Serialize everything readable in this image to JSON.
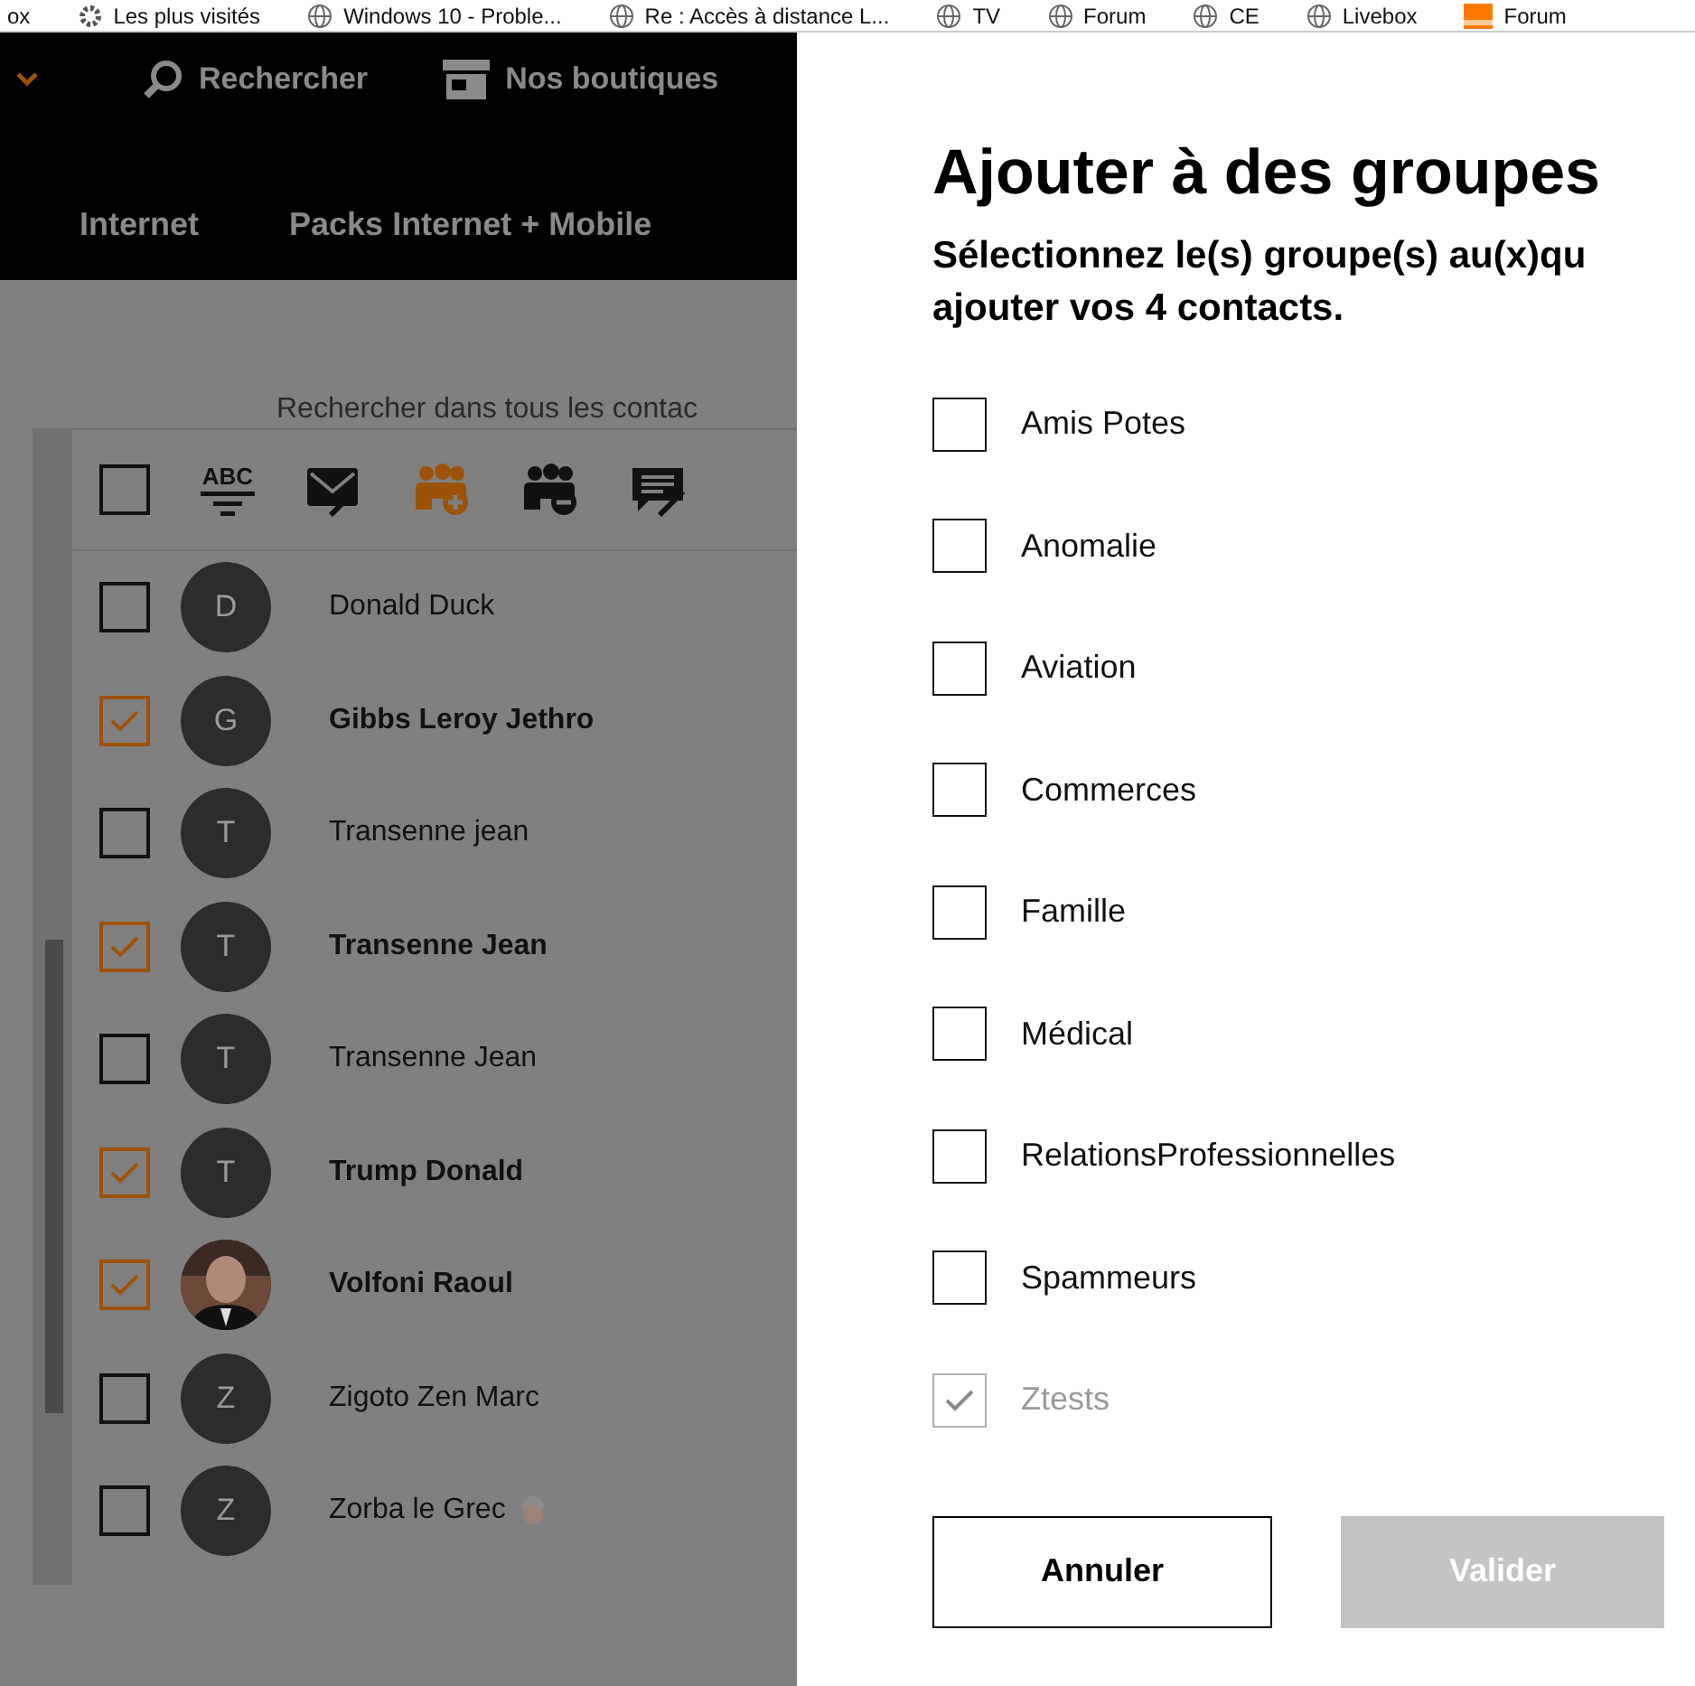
{
  "bookmarks": [
    {
      "label": "ox",
      "kind": "plain"
    },
    {
      "label": "Les plus visités",
      "kind": "gear"
    },
    {
      "label": "Windows 10 - Proble...",
      "kind": "globe"
    },
    {
      "label": "Re : Accès à distance L...",
      "kind": "globe"
    },
    {
      "label": "TV",
      "kind": "globe"
    },
    {
      "label": "Forum",
      "kind": "globe"
    },
    {
      "label": "CE",
      "kind": "globe"
    },
    {
      "label": "Livebox",
      "kind": "globe"
    },
    {
      "label": "Forum",
      "kind": "brand"
    }
  ],
  "header": {
    "search_label": "Rechercher",
    "shops_label": "Nos boutiques",
    "menu": [
      "Internet",
      "Packs Internet + Mobile"
    ]
  },
  "search_hint": "Rechercher dans tous les contac",
  "toolbar": {
    "select_all": false,
    "sort_label": "ABC"
  },
  "contacts": [
    {
      "name": "Donald Duck",
      "initial": "D",
      "kind": "initial",
      "checked": false,
      "emoji": false
    },
    {
      "name": "Gibbs Leroy Jethro",
      "initial": "G",
      "kind": "initial",
      "checked": true,
      "emoji": false
    },
    {
      "name": "Transenne jean",
      "initial": "T",
      "kind": "initial",
      "checked": false,
      "emoji": false
    },
    {
      "name": "Transenne Jean",
      "initial": "T",
      "kind": "initial",
      "checked": true,
      "emoji": false
    },
    {
      "name": "Transenne Jean",
      "initial": "T",
      "kind": "initial",
      "checked": false,
      "emoji": false
    },
    {
      "name": "Trump Donald",
      "initial": "T",
      "kind": "initial",
      "checked": true,
      "emoji": false
    },
    {
      "name": "Volfoni Raoul",
      "kind": "picture",
      "checked": true,
      "emoji": false
    },
    {
      "name": "Zigoto Zen Marc",
      "initial": "Z",
      "kind": "initial",
      "checked": false,
      "emoji": false
    },
    {
      "name": "Zorba le Grec",
      "initial": "Z",
      "kind": "initial",
      "checked": false,
      "emoji": true
    }
  ],
  "dialog": {
    "title": "Ajouter à des groupes",
    "subtitle_lines": [
      "Sélectionnez le(s) groupe(s) au(x)qu",
      "ajouter vos 4 contacts."
    ],
    "groups": [
      {
        "label": "Amis Potes",
        "checked": false,
        "disabled": false
      },
      {
        "label": "Anomalie",
        "checked": false,
        "disabled": false
      },
      {
        "label": "Aviation",
        "checked": false,
        "disabled": false
      },
      {
        "label": "Commerces",
        "checked": false,
        "disabled": false
      },
      {
        "label": "Famille",
        "checked": false,
        "disabled": false
      },
      {
        "label": "Médical",
        "checked": false,
        "disabled": false
      },
      {
        "label": "RelationsProfessionnelles",
        "checked": false,
        "disabled": false
      },
      {
        "label": "Spammeurs",
        "checked": false,
        "disabled": false
      },
      {
        "label": "Ztests",
        "checked": true,
        "disabled": true
      }
    ],
    "cancel": {
      "label": "Annuler",
      "disabled": false
    },
    "confirm": {
      "label": "Valider",
      "disabled": true
    }
  }
}
